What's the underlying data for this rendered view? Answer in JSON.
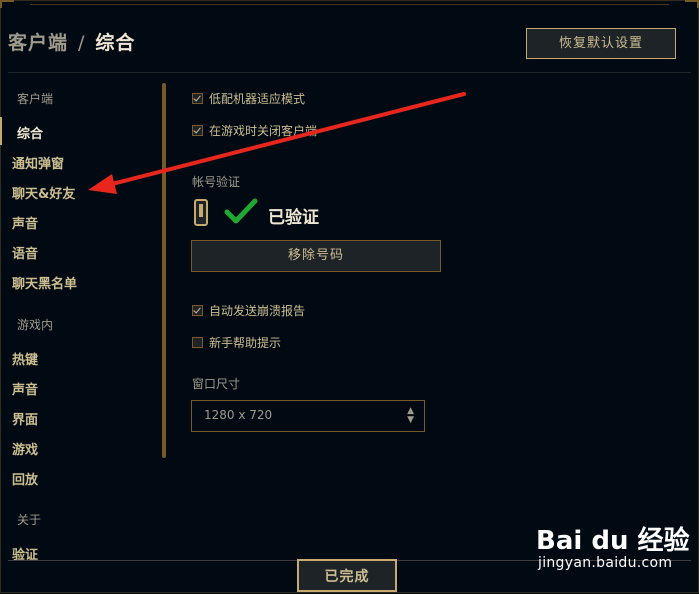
{
  "breadcrumb": {
    "parent": "客户端",
    "separator": "/",
    "current": "综合"
  },
  "header": {
    "restore_defaults_label": "恢复默认设置"
  },
  "sidebar": {
    "sections": [
      {
        "title": "客户端",
        "items": [
          "综合",
          "通知弹窗",
          "聊天&好友",
          "声音",
          "语音",
          "聊天黑名单"
        ]
      },
      {
        "title": "游戏内",
        "items": [
          "热键",
          "声音",
          "界面",
          "游戏",
          "回放"
        ]
      },
      {
        "title": "关于",
        "items": [
          "验证"
        ]
      }
    ],
    "active_item": "综合"
  },
  "options": {
    "low_spec_mode": {
      "label": "低配机器适应模式",
      "checked": true
    },
    "close_client_in_game": {
      "label": "在游戏时关闭客户端",
      "checked": true
    },
    "auto_send_crash": {
      "label": "自动发送崩溃报告",
      "checked": true
    },
    "newbie_tips": {
      "label": "新手帮助提示",
      "checked": false
    }
  },
  "account_verification": {
    "title": "帐号验证",
    "status": "已验证",
    "remove_button_label": "移除号码",
    "icons": [
      "phone-icon",
      "check-icon"
    ]
  },
  "window_size": {
    "title": "窗口尺寸",
    "value": "1280 x 720"
  },
  "footer": {
    "done_label": "已完成"
  },
  "watermark": {
    "logo_text": "Bai du 经验",
    "sub": "jingyan.baidu.com"
  },
  "colors": {
    "gold": "#c8aa6e",
    "background": "#010a13",
    "check_green": "#1fa832",
    "annotation_arrow": "#e8261e"
  }
}
